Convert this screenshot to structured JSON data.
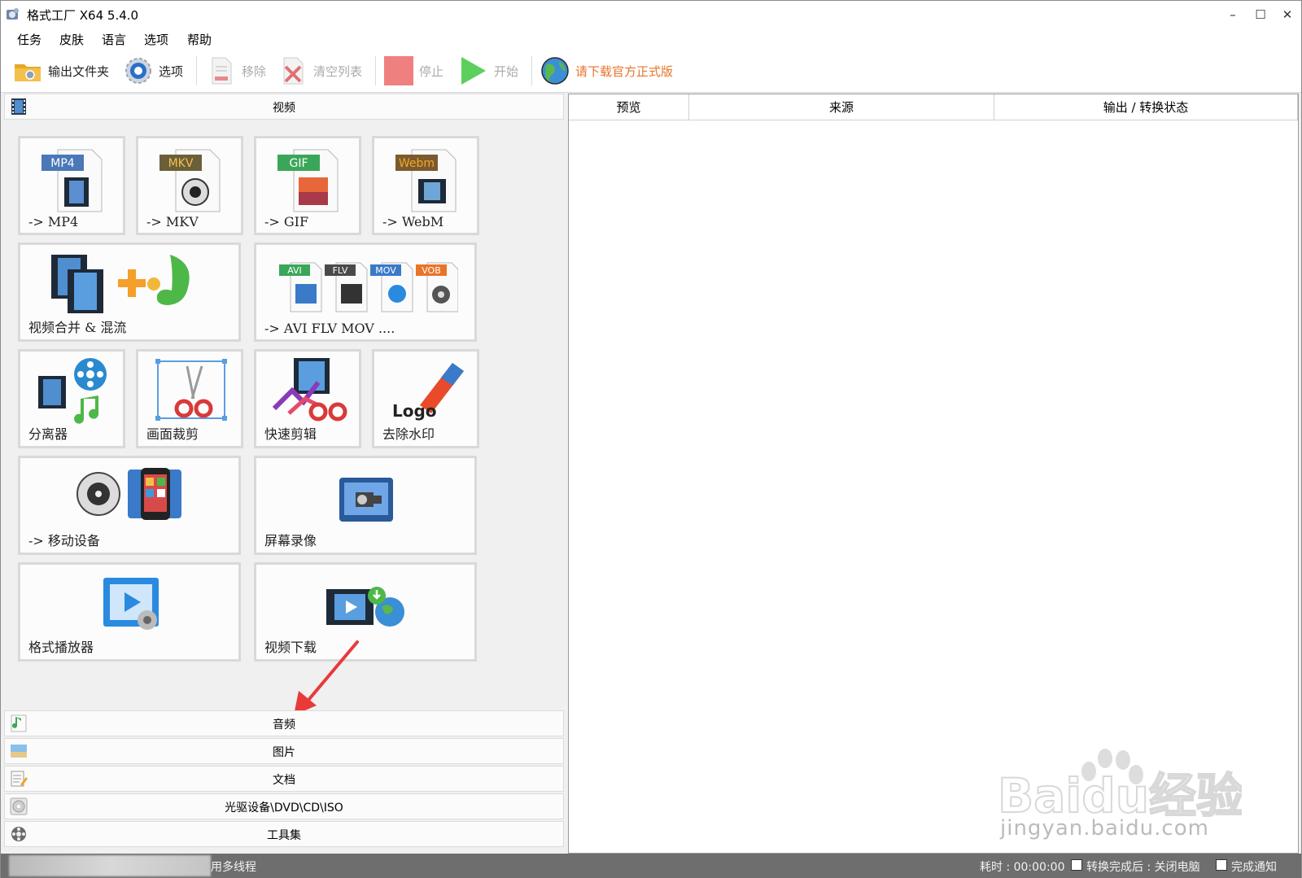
{
  "window": {
    "title": "格式工厂 X64 5.4.0",
    "controls": [
      "–",
      "☐",
      "✕"
    ]
  },
  "menu": [
    "任务",
    "皮肤",
    "语言",
    "选项",
    "帮助"
  ],
  "toolbar": {
    "output_folder": "输出文件夹",
    "options": "选项",
    "remove": "移除",
    "clear_list": "清空列表",
    "stop": "停止",
    "start": "开始",
    "download_official": "请下载官方正式版"
  },
  "categories": {
    "video": "视频",
    "audio": "音频",
    "image": "图片",
    "document": "文档",
    "disc": "光驱设备\\DVD\\CD\\ISO",
    "tools": "工具集"
  },
  "video_tiles": [
    {
      "label": "-> MP4",
      "badge": "MP4"
    },
    {
      "label": "-> MKV",
      "badge": "MKV"
    },
    {
      "label": "-> GIF",
      "badge": "GIF"
    },
    {
      "label": "-> WebM",
      "badge": "Webm"
    },
    {
      "label": "视频合并 & 混流"
    },
    {
      "label": "-> AVI FLV MOV ....",
      "badges": [
        "AVI",
        "FLV",
        "MOV",
        "VOB"
      ]
    },
    {
      "label": "分离器"
    },
    {
      "label": "画面裁剪"
    },
    {
      "label": "快速剪辑"
    },
    {
      "label": "去除水印",
      "logo_text": "Logo"
    },
    {
      "label": "-> 移动设备"
    },
    {
      "label": "屏幕录像"
    },
    {
      "label": "格式播放器"
    },
    {
      "label": "视频下载"
    }
  ],
  "table": {
    "columns": [
      "预览",
      "来源",
      "输出 / 转换状态"
    ]
  },
  "status": {
    "threads": "用多线程",
    "elapsed": "耗时 : 00:00:00",
    "shutdown": "转换完成后 : 关闭电脑",
    "notify": "完成通知"
  },
  "watermark": {
    "brand": "Baidu经验",
    "url": "jingyan.baidu.com"
  },
  "colors": {
    "accent_orange": "#e8742a",
    "stop_red": "#f08080",
    "start_green": "#5ccf5c",
    "statusbar": "#6e6e6e"
  }
}
